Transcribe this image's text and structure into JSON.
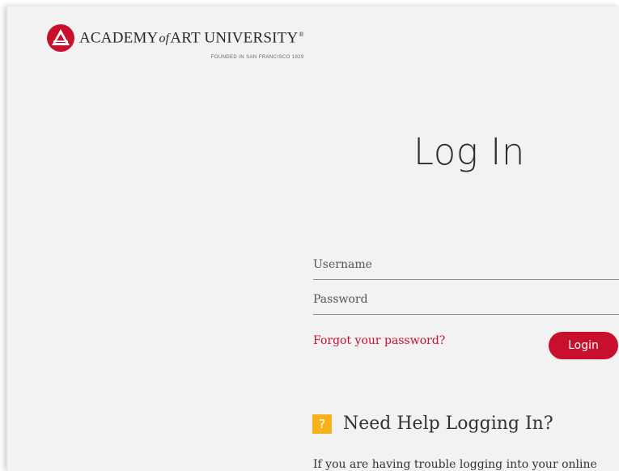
{
  "brand": {
    "name_before": "ACADEMY",
    "name_of": "of",
    "name_after": "ART UNIVERSITY",
    "registered": "®",
    "tagline": "FOUNDED IN SAN FRANCISCO 1929",
    "accent_color": "#c8102e"
  },
  "login": {
    "title": "Log In",
    "username_placeholder": "Username",
    "password_placeholder": "Password",
    "forgot_label": "Forgot your password?",
    "submit_label": "Login"
  },
  "help": {
    "icon": "question-mark-icon",
    "icon_glyph": "?",
    "icon_color": "#f6b21b",
    "heading": "Need Help Logging In?",
    "body": "If you are having trouble logging into your online"
  }
}
